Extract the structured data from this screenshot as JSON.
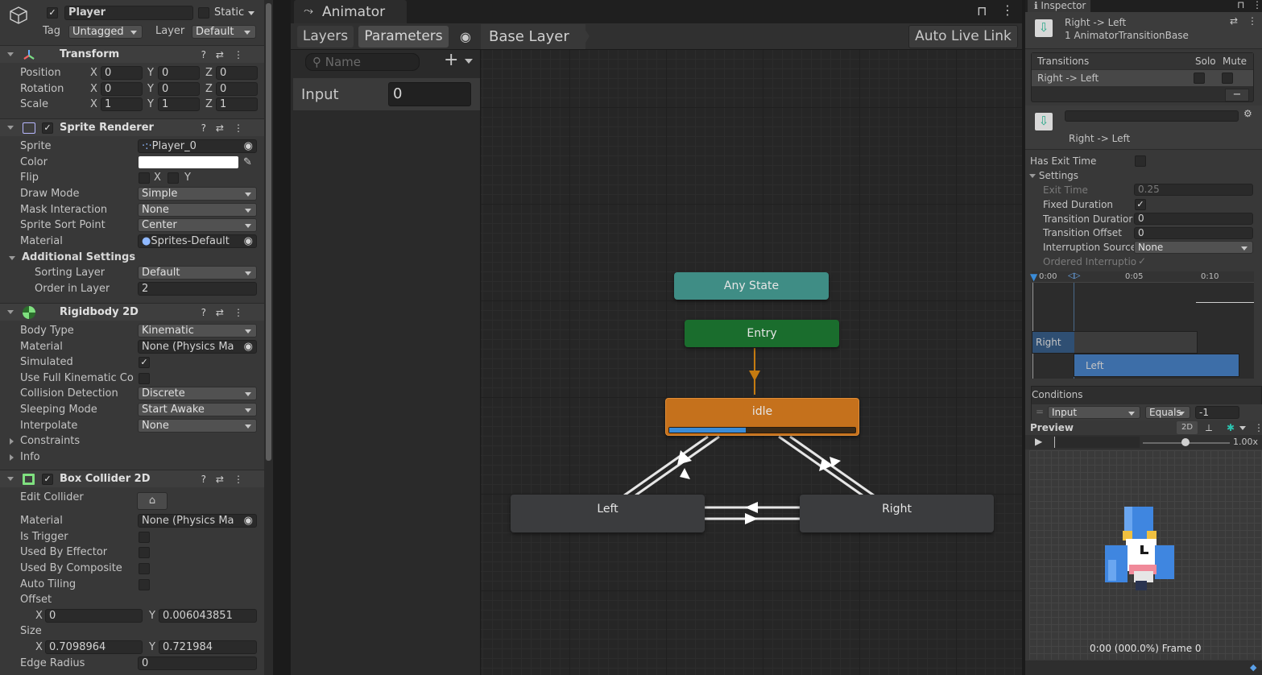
{
  "inspector": {
    "object_name": "Player",
    "static_label": "Static",
    "tag_label": "Tag",
    "tag_value": "Untagged",
    "layer_label": "Layer",
    "layer_value": "Default",
    "transform": {
      "title": "Transform",
      "position_label": "Position",
      "position": {
        "x": "0",
        "y": "0",
        "z": "0"
      },
      "rotation_label": "Rotation",
      "rotation": {
        "x": "0",
        "y": "0",
        "z": "0"
      },
      "scale_label": "Scale",
      "scale": {
        "x": "1",
        "y": "1",
        "z": "1"
      }
    },
    "sprite_renderer": {
      "title": "Sprite Renderer",
      "sprite_label": "Sprite",
      "sprite_value": "Player_0",
      "color_label": "Color",
      "color_value": "#ffffff",
      "flip_label": "Flip",
      "flip_x": "X",
      "flip_y": "Y",
      "draw_mode_label": "Draw Mode",
      "draw_mode_value": "Simple",
      "mask_label": "Mask Interaction",
      "mask_value": "None",
      "sort_point_label": "Sprite Sort Point",
      "sort_point_value": "Center",
      "material_label": "Material",
      "material_value": "Sprites-Default",
      "additional_label": "Additional Settings",
      "sorting_layer_label": "Sorting Layer",
      "sorting_layer_value": "Default",
      "order_label": "Order in Layer",
      "order_value": "2"
    },
    "rigidbody": {
      "title": "Rigidbody 2D",
      "body_type_label": "Body Type",
      "body_type_value": "Kinematic",
      "material_label": "Material",
      "material_value": "None (Physics Ma",
      "simulated_label": "Simulated",
      "full_kinematic_label": "Use Full Kinematic Co",
      "collision_label": "Collision Detection",
      "collision_value": "Discrete",
      "sleeping_label": "Sleeping Mode",
      "sleeping_value": "Start Awake",
      "interpolate_label": "Interpolate",
      "interpolate_value": "None",
      "constraints_label": "Constraints",
      "info_label": "Info"
    },
    "box_collider": {
      "title": "Box Collider 2D",
      "edit_label": "Edit Collider",
      "material_label": "Material",
      "material_value": "None (Physics Ma",
      "trigger_label": "Is Trigger",
      "effector_label": "Used By Effector",
      "composite_label": "Used By Composite",
      "tiling_label": "Auto Tiling",
      "offset_label": "Offset",
      "offset": {
        "x": "0",
        "y": "0.006043851"
      },
      "size_label": "Size",
      "size": {
        "x": "0.7098964",
        "y": "0.721984"
      },
      "edge_label": "Edge Radius",
      "edge_value": "0"
    },
    "axis": {
      "x": "X",
      "y": "Y",
      "z": "Z"
    }
  },
  "animator": {
    "tab_title": "Animator",
    "layers_tab": "Layers",
    "parameters_tab": "Parameters",
    "breadcrumb": "Base Layer",
    "auto_live_link": "Auto Live Link",
    "search_placeholder": "Name",
    "parameters": [
      {
        "name": "Input",
        "value": "0"
      }
    ],
    "states": {
      "any_state": "Any State",
      "entry": "Entry",
      "idle": "idle",
      "left": "Left",
      "right": "Right"
    },
    "idle_progress": 0.41
  },
  "right_inspector": {
    "tab_title": "Inspector",
    "header_title": "Right -> Left",
    "header_subtitle": "1 AnimatorTransitionBase",
    "transitions_label": "Transitions",
    "solo_label": "Solo",
    "mute_label": "Mute",
    "transition_row": "Right -> Left",
    "transition_name": "Right -> Left",
    "has_exit_time_label": "Has Exit Time",
    "settings_label": "Settings",
    "exit_time_label": "Exit Time",
    "exit_time_value": "0.25",
    "fixed_duration_label": "Fixed Duration",
    "transition_duration_label": "Transition Duratior",
    "transition_duration_value": "0",
    "transition_offset_label": "Transition Offset",
    "transition_offset_value": "0",
    "interruption_label": "Interruption Source",
    "interruption_value": "None",
    "ordered_label": "Ordered Interruptio",
    "timeline_ticks": [
      "0:00",
      "0:05",
      "0:10"
    ],
    "timeline_right": "Right",
    "timeline_left": "Left",
    "conditions_label": "Conditions",
    "condition_param": "Input",
    "condition_op": "Equals",
    "condition_value": "-1",
    "preview_label": "Preview",
    "preview_2d": "2D",
    "speed": "1.00x",
    "frame_info": "0:00 (000.0%) Frame 0"
  }
}
